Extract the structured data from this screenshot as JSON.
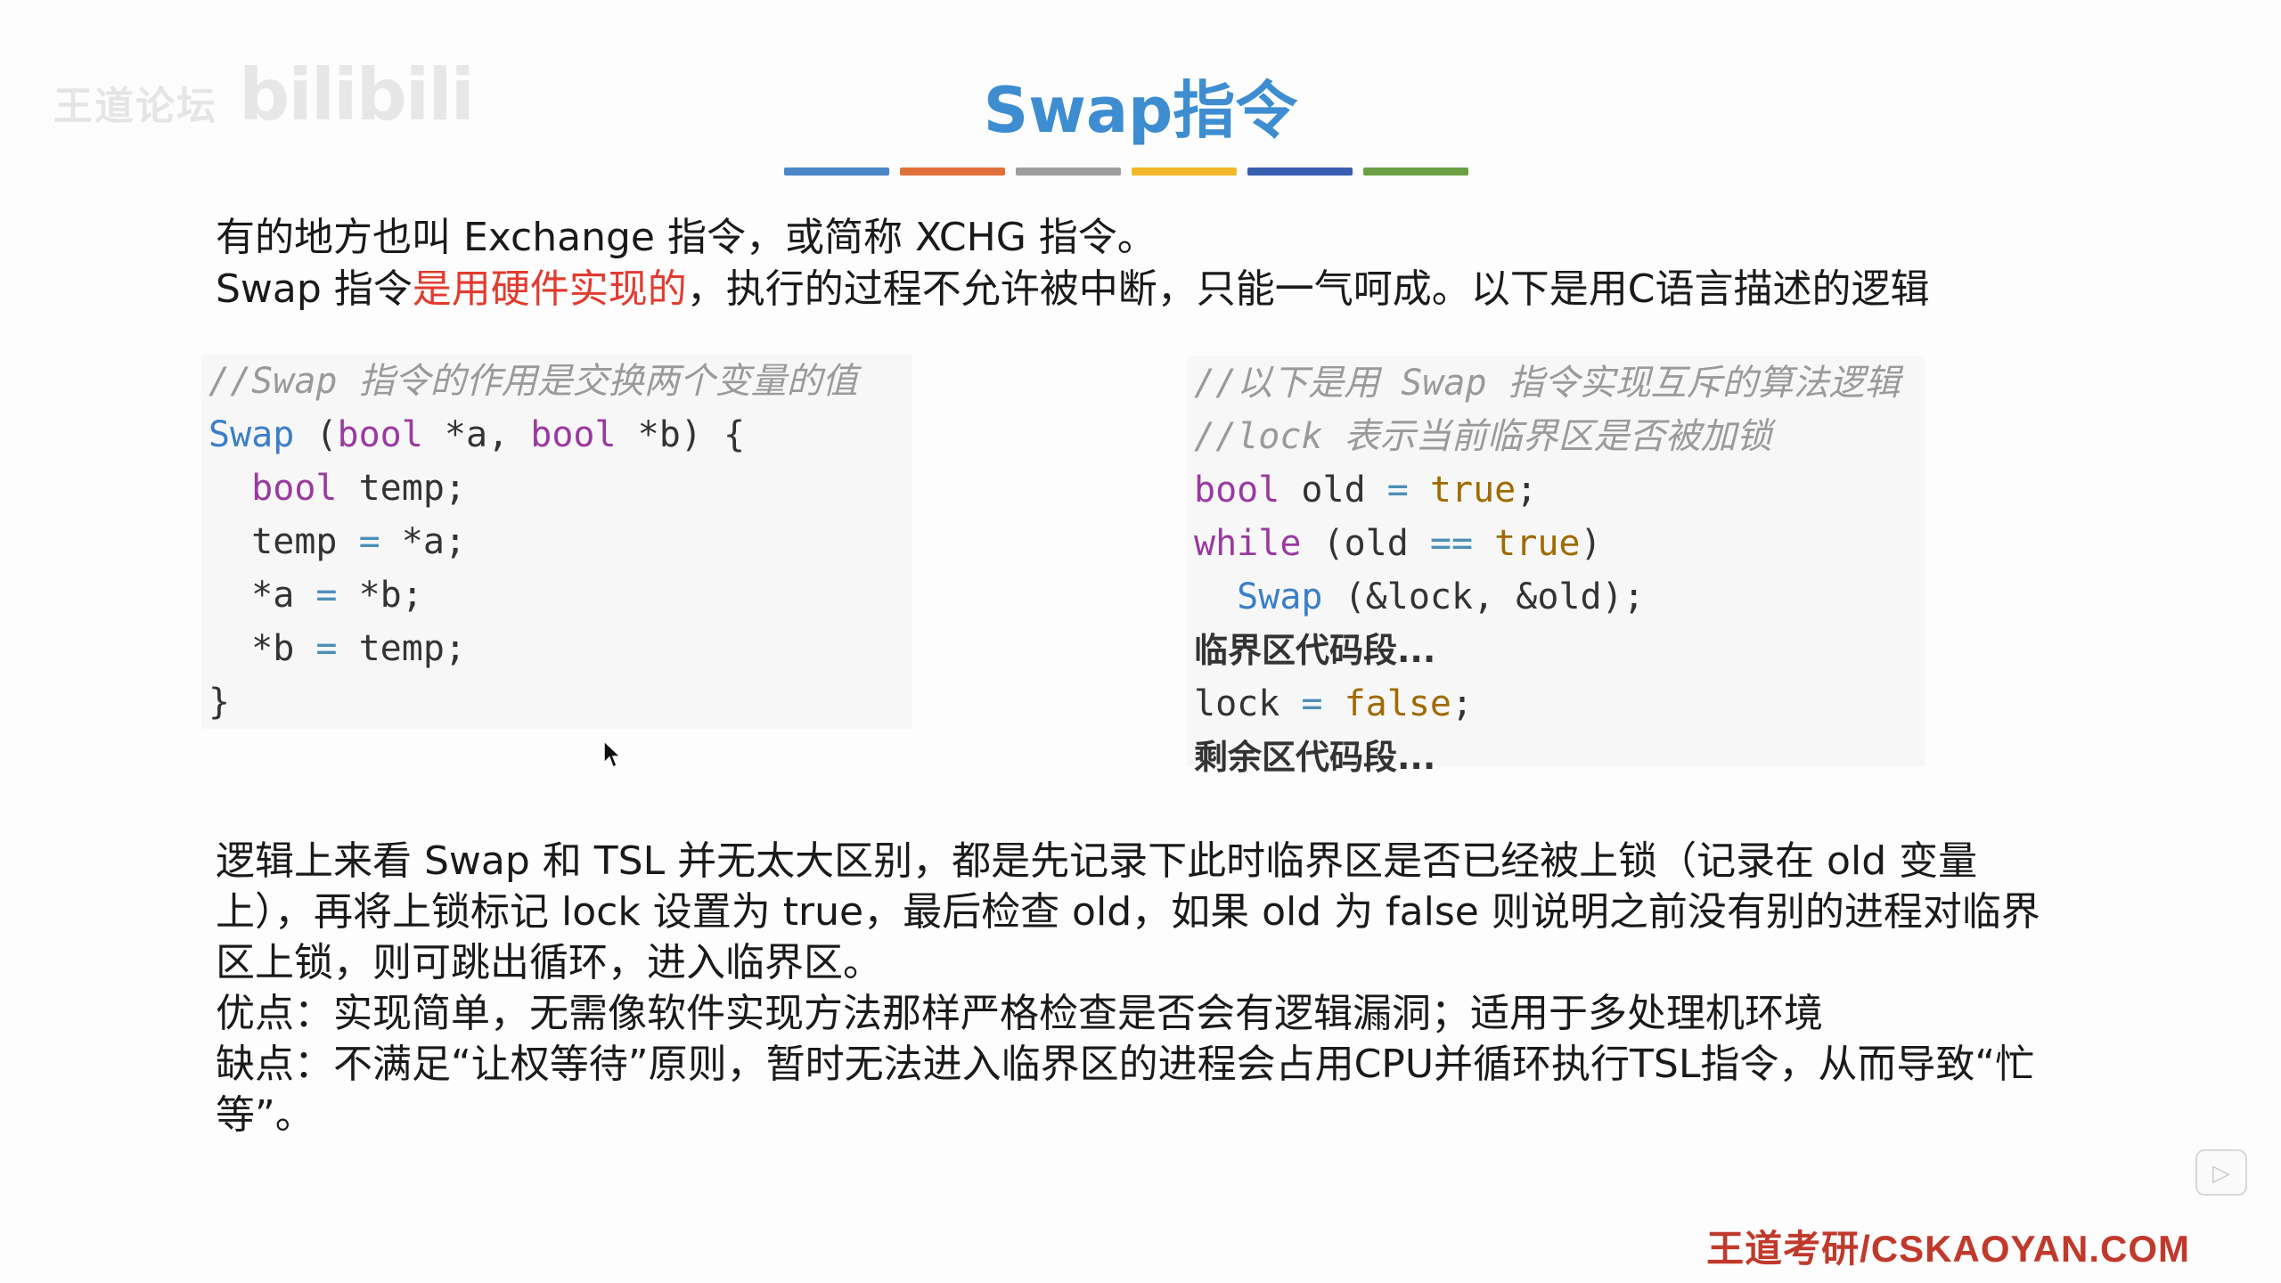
{
  "watermark": {
    "text": "王道论坛",
    "bili": "bilibili"
  },
  "title": "Swap指令",
  "color_bar": [
    "#4a86c8",
    "#e0703a",
    "#9e9e9e",
    "#f2b72a",
    "#3b5fb0",
    "#6aa043"
  ],
  "intro": {
    "line1": "有的地方也叫 Exchange 指令，或简称 XCHG 指令。",
    "line2_pre": "Swap 指令",
    "line2_red": "是用硬件实现的",
    "line2_post": "，执行的过程不允许被中断，只能一气呵成。以下是用C语言描述的逻辑"
  },
  "code_left": {
    "comment": "//Swap 指令的作用是交换两个变量的值",
    "sig_fn": "Swap",
    "sig_p1": " (",
    "sig_kw1": "bool",
    "sig_p2": " *a, ",
    "sig_kw2": "bool",
    "sig_p3": " *b) {",
    "l1_kw": "bool",
    "l1_rest": " temp;",
    "l2_a": "temp ",
    "l2_op": "=",
    "l2_b": " *a;",
    "l3_a": "*a ",
    "l3_op": "=",
    "l3_b": " *b;",
    "l4_a": "*b ",
    "l4_op": "=",
    "l4_b": " temp;",
    "close": "}"
  },
  "code_right": {
    "comment1": "//以下是用 Swap 指令实现互斥的算法逻辑",
    "comment2": "//lock 表示当前临界区是否被加锁",
    "l1_kw": "bool",
    "l1_mid": " old ",
    "l1_op": "=",
    "l1_lit": " true",
    "l1_end": ";",
    "l2_kw": "while",
    "l2_mid": " (old ",
    "l2_op": "==",
    "l2_lit": " true",
    "l2_end": ")",
    "l3_fn": "Swap",
    "l3_rest": " (&lock, &old);",
    "l4": "临界区代码段...",
    "l5_a": "lock ",
    "l5_op": "=",
    "l5_lit": " false",
    "l5_end": ";",
    "l6": "剩余区代码段..."
  },
  "summary": {
    "p1": "逻辑上来看 Swap 和 TSL 并无太大区别，都是先记录下此时临界区是否已经被上锁（记录在 old 变量上），再将上锁标记 lock 设置为 true，最后检查 old，如果 old 为 false 则说明之前没有别的进程对临界区上锁，则可跳出循环，进入临界区。",
    "p2": "优点：实现简单，无需像软件实现方法那样严格检查是否会有逻辑漏洞；适用于多处理机环境",
    "p3": "缺点：不满足“让权等待”原则，暂时无法进入临界区的进程会占用CPU并循环执行TSL指令，从而导致“忙等”。"
  },
  "footer": "王道考研/CSKAOYAN.COM"
}
